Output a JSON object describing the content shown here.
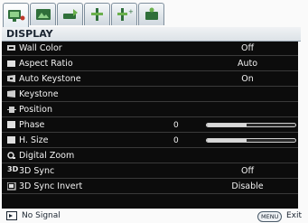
{
  "tabs": [
    {
      "icon": "display-icon",
      "active": true
    },
    {
      "icon": "picture-icon",
      "active": false
    },
    {
      "icon": "source-icon",
      "active": false
    },
    {
      "icon": "system-setup-basic-icon",
      "active": false
    },
    {
      "icon": "system-setup-advanced-icon",
      "active": false
    },
    {
      "icon": "information-icon",
      "active": false
    }
  ],
  "menu_title": "DISPLAY",
  "items": [
    {
      "label": "Wall Color",
      "value": "Off",
      "icon": "wall-color-icon"
    },
    {
      "label": "Aspect Ratio",
      "value": "Auto",
      "icon": "aspect-ratio-icon"
    },
    {
      "label": "Auto Keystone",
      "value": "On",
      "icon": "auto-keystone-icon"
    },
    {
      "label": "Keystone",
      "value": "",
      "icon": "keystone-icon"
    },
    {
      "label": "Position",
      "value": "",
      "icon": "position-icon"
    },
    {
      "label": "Phase",
      "number": "0",
      "level": 0.45,
      "icon": "phase-icon"
    },
    {
      "label": "H. Size",
      "number": "0",
      "level": 0.45,
      "icon": "h-size-icon"
    },
    {
      "label": "Digital Zoom",
      "value": "",
      "icon": "digital-zoom-icon"
    },
    {
      "label": "3D Sync",
      "value": "Off",
      "icon": "3d-sync-icon",
      "icon_text": "3D"
    },
    {
      "label": "3D Sync Invert",
      "value": "Disable",
      "icon": "3d-sync-invert-icon"
    }
  ],
  "footer": {
    "status": "No Signal",
    "menu_key": "MENU",
    "exit": "Exit"
  },
  "colors": {
    "panel": "#0c0c0c",
    "row_text": "#f2f2f2",
    "header_text": "#1a2430"
  }
}
